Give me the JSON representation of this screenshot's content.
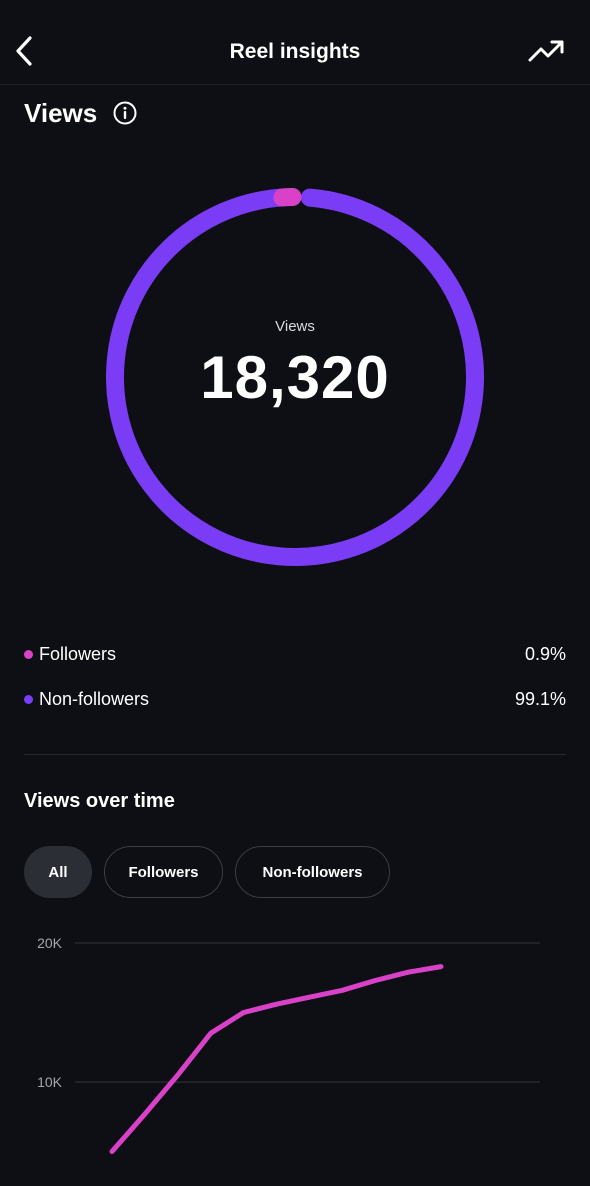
{
  "header": {
    "title": "Reel insights",
    "back_icon": "chevron-left-icon",
    "trend_icon": "trending-up-icon"
  },
  "views_section": {
    "heading": "Views",
    "info_icon": "info-icon",
    "ring_label": "Views",
    "total": "18,320",
    "breakdown": [
      {
        "label": "Followers",
        "value": "0.9%",
        "fraction": 0.009,
        "color": "#d942c8"
      },
      {
        "label": "Non-followers",
        "value": "99.1%",
        "fraction": 0.991,
        "color": "#7a3cf5"
      }
    ]
  },
  "views_over_time": {
    "title": "Views over time",
    "filters": [
      {
        "label": "All",
        "active": true
      },
      {
        "label": "Followers",
        "active": false
      },
      {
        "label": "Non-followers",
        "active": false
      }
    ]
  },
  "chart_data": {
    "type": "line",
    "title": "",
    "xlabel": "",
    "ylabel": "",
    "y_ticks": [
      {
        "value": 20000,
        "label": "20K"
      },
      {
        "value": 10000,
        "label": "10K"
      }
    ],
    "ylim": [
      0,
      20000
    ],
    "grid": true,
    "series": [
      {
        "color": "#d942c8",
        "x": [
          0,
          1,
          2,
          3,
          4,
          5,
          6,
          7,
          8,
          9,
          10
        ],
        "y": [
          5000,
          7700,
          10500,
          13500,
          15000,
          15600,
          16100,
          16600,
          17300,
          17900,
          18300
        ]
      }
    ],
    "x_max": 10
  }
}
